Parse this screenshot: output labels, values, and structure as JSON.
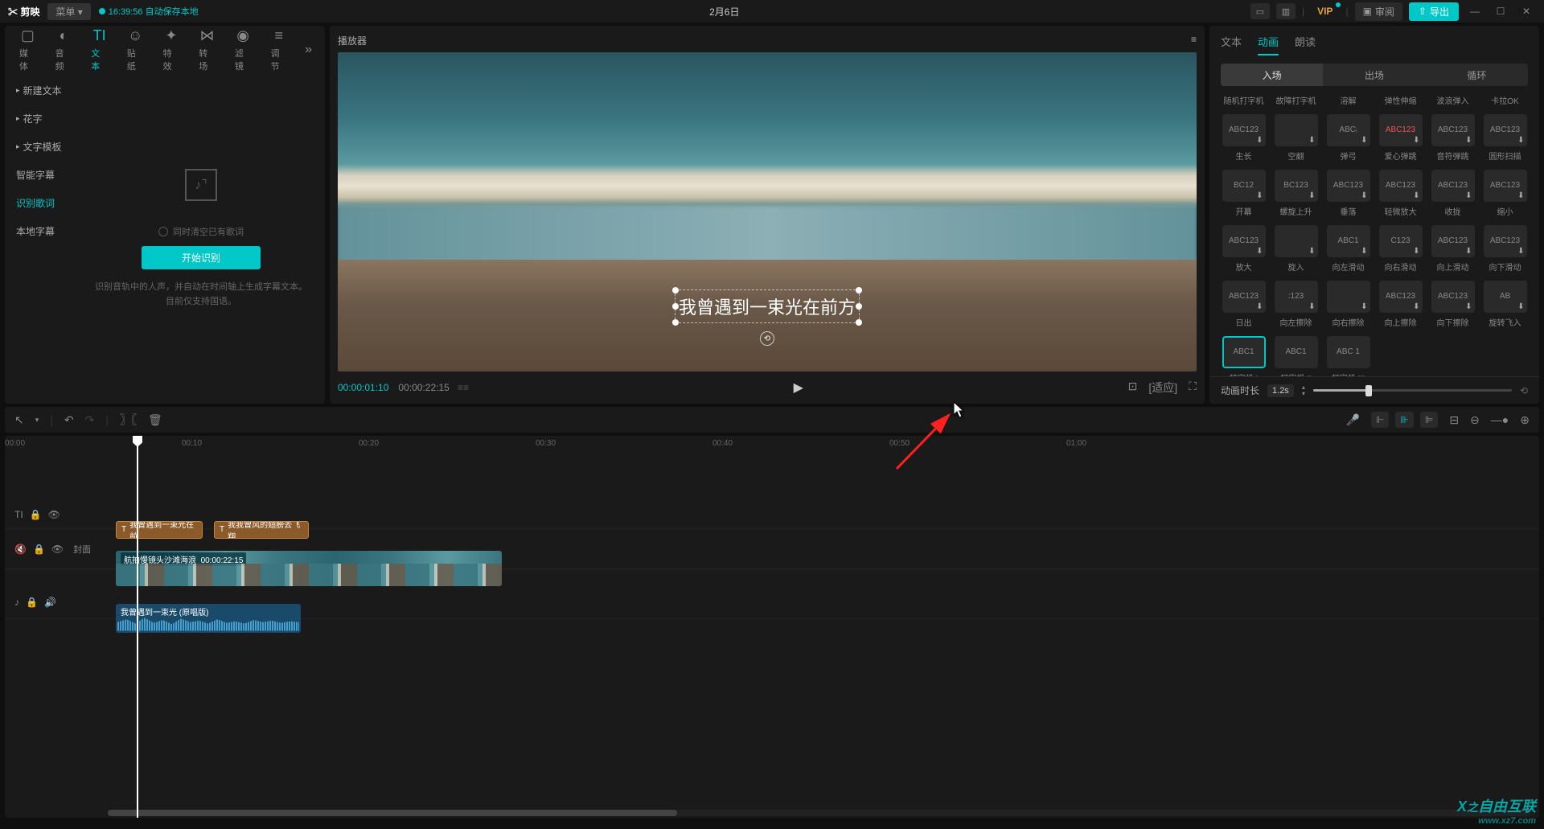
{
  "titlebar": {
    "logo": "✂ 剪映",
    "menu": "菜单",
    "autosave": "16:39:56 自动保存本地",
    "project": "2月6日",
    "vip": "VIP",
    "review": "审阅",
    "export": "导出"
  },
  "top_tabs": {
    "media": "媒体",
    "audio": "音频",
    "text": "文本",
    "sticker": "贴纸",
    "effect": "特效",
    "transition": "转场",
    "filter": "滤镜",
    "adjust": "调节"
  },
  "sidebar": {
    "new_text": "新建文本",
    "fancy": "花字",
    "template": "文字模板",
    "smart_sub": "智能字幕",
    "lyrics": "识别歌词",
    "local_sub": "本地字幕"
  },
  "lyrics_panel": {
    "clear_cb": "同时清空已有歌词",
    "start": "开始识别",
    "desc": "识别音轨中的人声，并自动在时间轴上生成字幕文本。目前仅支持国语。"
  },
  "player": {
    "title": "播放器",
    "cur": "00:00:01:10",
    "dur": "00:00:22:15",
    "subtitle": "我曾遇到一束光在前方",
    "ratio": "[适应]"
  },
  "right": {
    "tabs": {
      "text": "文本",
      "anim": "动画",
      "read": "朗读"
    },
    "subtabs": {
      "in": "入场",
      "out": "出场",
      "loop": "循环"
    },
    "headers": [
      "随机打字机",
      "故障打字机",
      "溶解",
      "弹性伸缩",
      "波浪弹入",
      "卡拉OK"
    ],
    "row2": {
      "labels": [
        "生长",
        "空翻",
        "弹弓",
        "爱心弹跳",
        "音符弹跳",
        "圆形扫描"
      ],
      "thumbs": [
        "ABC123",
        "",
        "ABCᵢ",
        "ABC123",
        "ABC123",
        "ABC123"
      ]
    },
    "row3": {
      "labels": [
        "开幕",
        "螺旋上升",
        "垂落",
        "轻微放大",
        "收拢",
        "缩小"
      ],
      "thumbs": [
        "BC12",
        "BC123",
        "ABC123",
        "ABC123",
        "ABC123",
        "ABC123"
      ]
    },
    "row4": {
      "labels": [
        "放大",
        "旋入",
        "向左滑动",
        "向右滑动",
        "向上滑动",
        "向下滑动"
      ],
      "thumbs": [
        "ABC123",
        "",
        "ABC1",
        "C123",
        "ABC123",
        "ABC123"
      ]
    },
    "row5": {
      "labels": [
        "日出",
        "向左擦除",
        "向右擦除",
        "向上擦除",
        "向下擦除",
        "旋转飞入"
      ],
      "thumbs": [
        "ABC123",
        ":123",
        "",
        "ABC123",
        "ABC123",
        "AB"
      ]
    },
    "row6": {
      "labels": [
        "打字机 I",
        "打字机 II",
        "打字机 III"
      ],
      "thumbs": [
        "ABC1",
        "ABC1",
        "ABC  1"
      ]
    },
    "duration_label": "动画时长",
    "duration_val": "1.2s"
  },
  "timeline": {
    "ticks": [
      "00:00",
      "00:10",
      "00:20",
      "00:30",
      "00:40",
      "00:50",
      "01:00"
    ],
    "cover": "封面",
    "text_clip1": "我曾遇到一束光在前",
    "text_clip2": "我我曾风的翅膀去飞翔",
    "video_name": "航拍慢镜头沙滩海浪",
    "video_dur": "00:00:22:15",
    "audio_name": "我曾遇到一束光 (原唱版)"
  },
  "watermark": {
    "name": "自由互联",
    "url": "www.xz7.com"
  }
}
